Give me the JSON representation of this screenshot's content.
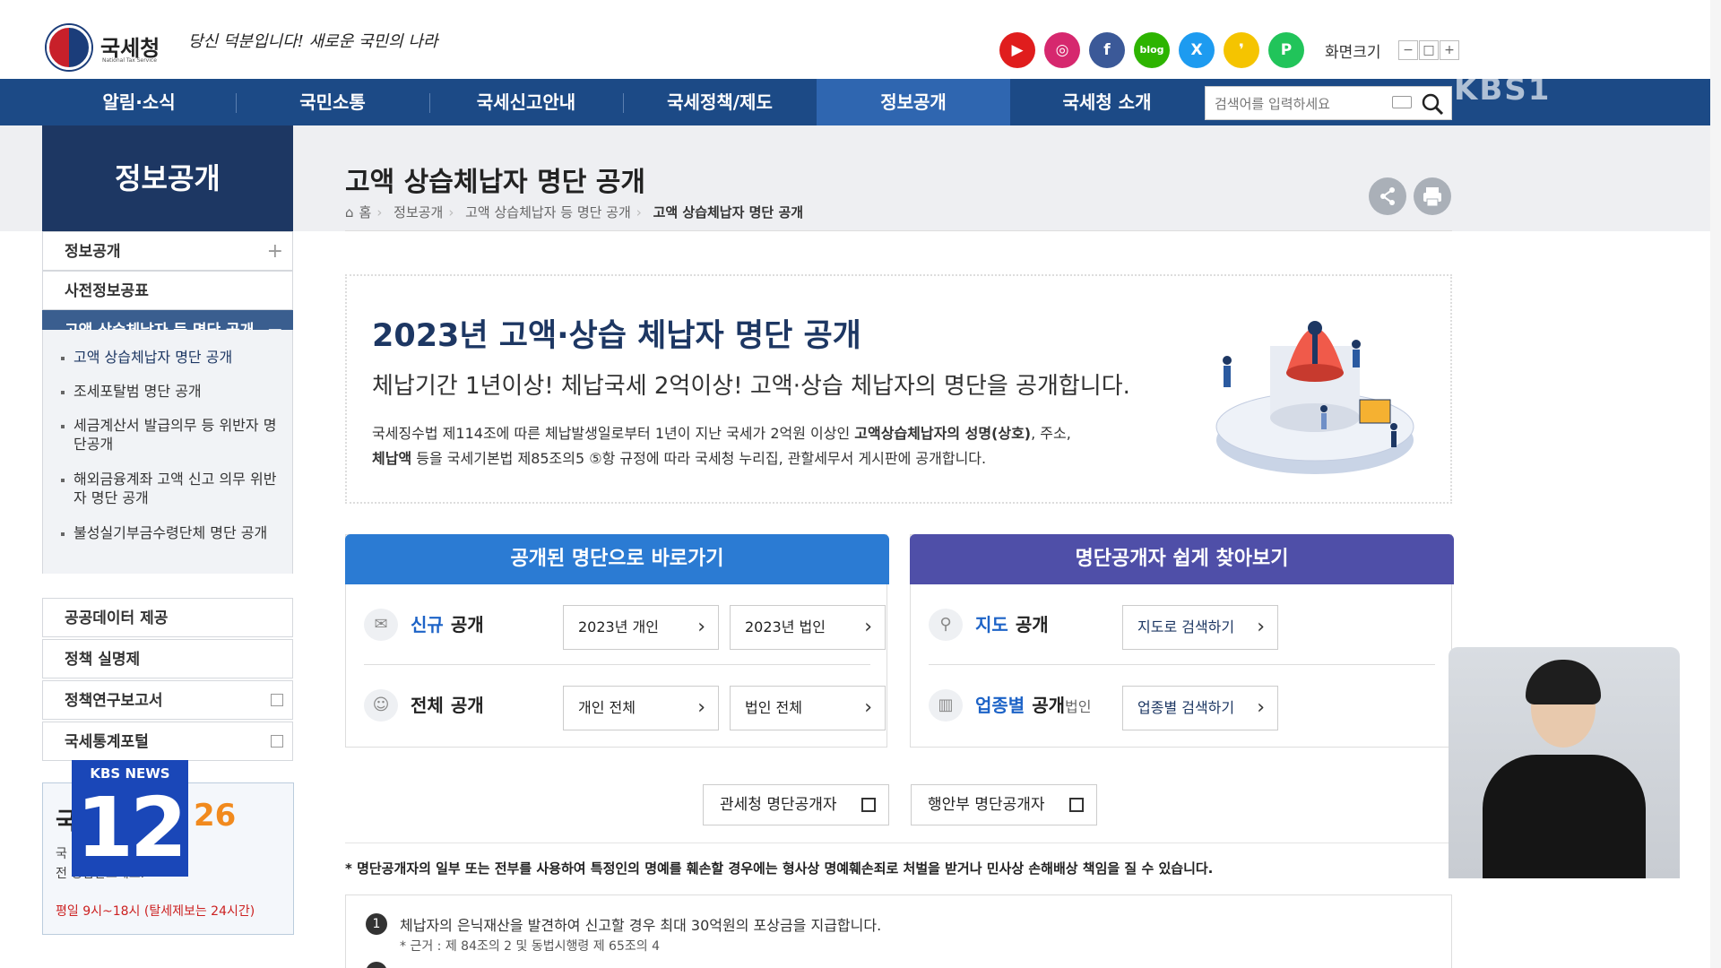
{
  "header": {
    "logo_text": "국세청",
    "logo_sub": "National Tax Service",
    "slogan": "당신 덕분입니다! 새로운 국민의 나라",
    "zoom_label": "화면크기",
    "zoom_buttons": [
      "−",
      "□",
      "+"
    ],
    "sns": [
      {
        "name": "youtube",
        "glyph": "▶",
        "color": "#e01d1d"
      },
      {
        "name": "instagram",
        "glyph": "◎",
        "color": "#d6286e"
      },
      {
        "name": "facebook",
        "glyph": "f",
        "color": "#3b5998"
      },
      {
        "name": "blog",
        "glyph": "blog",
        "color": "#2db400"
      },
      {
        "name": "x",
        "glyph": "X",
        "color": "#1d9bf0"
      },
      {
        "name": "kakao",
        "glyph": "❜",
        "color": "#f5c400"
      },
      {
        "name": "post",
        "glyph": "P",
        "color": "#21c45a"
      }
    ]
  },
  "nav": {
    "items": [
      "알림·소식",
      "국민소통",
      "국세신고안내",
      "국세정책/제도",
      "정보공개",
      "국세청 소개"
    ],
    "active_index": 4,
    "search_placeholder": "검색어를 입력하세요",
    "watermark": "KBS1"
  },
  "sidebar": {
    "title": "정보공개",
    "items": [
      {
        "label": "정보공개",
        "marker": "+"
      },
      {
        "label": "사전정보공표",
        "marker": ""
      },
      {
        "label": "고액 상습체납자 등 명단 공개",
        "marker": "−"
      }
    ],
    "subitems": [
      "고액 상습체납자 명단 공개",
      "조세포탈범 명단 공개",
      "세금계산서 발급의무 등 위반자 명단공개",
      "해외금융계좌 고액 신고 의무 위반자 명단 공개",
      "불성실기부금수령단체 명단 공개"
    ],
    "items_after": [
      {
        "label": "공공데이터 제공",
        "external": false
      },
      {
        "label": "정책 실명제",
        "external": false
      },
      {
        "label": "정책연구보고서",
        "external": true
      },
      {
        "label": "국세통계포털",
        "external": true
      }
    ],
    "consult": {
      "title": "국",
      "number": "26",
      "line1": "국 번없이 126",
      "line2": "전 상담받으세요.",
      "hours": "평일 9시~18시 (탈세제보는 24시간)"
    }
  },
  "overlay": {
    "kbs_label": "KBS NEWS",
    "kbs_number": "12"
  },
  "main": {
    "title": "고액 상습체납자 명단 공개",
    "breadcrumb": [
      "홈",
      "정보공개",
      "고액 상습체납자 등 명단 공개",
      "고액 상습체납자 명단 공개"
    ],
    "banner": {
      "title": "2023년 고액·상습 체납자 명단 공개",
      "subtitle": "체납기간 1년이상! 체납국세 2억이상! 고액·상습 체납자의 명단을 공개합니다.",
      "desc1_a": "국세징수법 제114조에 따른 체납발생일로부터 1년이 지난 국세가 2억원 이상인 ",
      "desc1_b": "고액상습체납자의 성명(상호)",
      "desc1_c": ", 주소,",
      "desc2_a": "체납액",
      "desc2_b": " 등을 국세기본법 제85조의5 ⑤항 규정에 따라 국세청 누리집, 관할세무서 게시판에 공개합니다."
    },
    "left_panel": {
      "title": "공개된 명단으로 바로가기",
      "color": "#2b7bd3",
      "rows": [
        {
          "b": "신규",
          "t": "공개",
          "buttons": [
            "2023년 개인",
            "2023년 법인"
          ]
        },
        {
          "b": "전체",
          "t": "공개",
          "buttons": [
            "개인 전체",
            "법인 전체"
          ]
        }
      ]
    },
    "right_panel": {
      "title": "명단공개자 쉽게 찾아보기",
      "color": "#4f4fa8",
      "rows": [
        {
          "b": "지도",
          "t": "공개",
          "small": "",
          "button": "지도로 검색하기"
        },
        {
          "b": "업종별",
          "t": "공개",
          "small": "법인",
          "button": "업종별 검색하기"
        }
      ]
    },
    "external_buttons": [
      "관세청 명단공개자",
      "행안부 명단공개자"
    ],
    "disclaimer": "* 명단공개자의 일부 또는 전부를 사용하여 특정인의 명예를 훼손할 경우에는 형사상 명예훼손죄로 처벌을 받거나 민사상 손해배상 책임을 질 수 있습니다.",
    "notice": {
      "num": "1",
      "text": "체납자의 은닉재산을 발견하여 신고할 경우 최대 30억원의 포상금을 지급합니다.",
      "sub": "* 근거 : 제 84조의 2 및 동법시행령 제 65조의 4"
    }
  }
}
